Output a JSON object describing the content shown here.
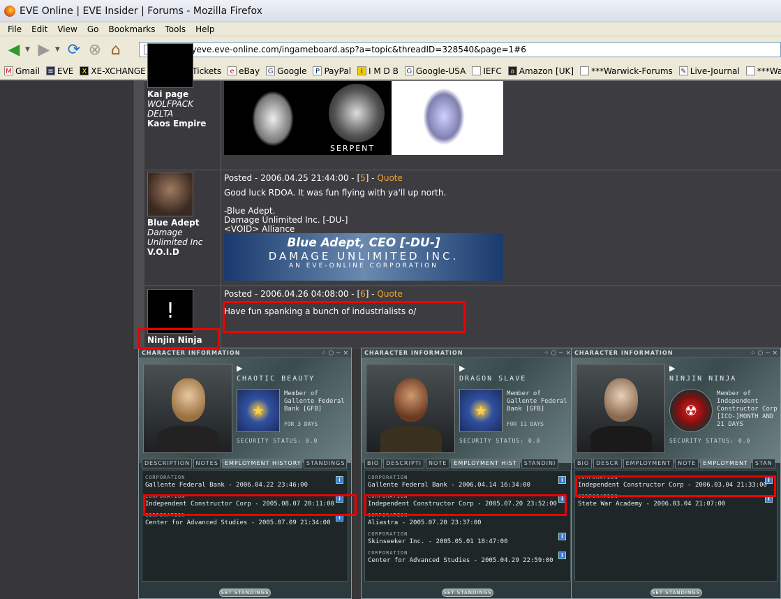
{
  "window": {
    "title": "EVE Online | EVE Insider | Forums - Mozilla Firefox"
  },
  "menu": [
    "File",
    "Edit",
    "View",
    "Go",
    "Bookmarks",
    "Tools",
    "Help"
  ],
  "nav": {
    "url": "http://myeve.eve-online.com/ingameboard.asp?a=topic&threadID=328540&page=1#6"
  },
  "bookmarks": [
    "Gmail",
    "EVE",
    "XE-XCHANGE",
    "Cheap-Tickets",
    "eBay",
    "Google",
    "PayPal",
    "I M D B",
    "Google-USA",
    "IEFC",
    "Amazon [UK]",
    "***Warwick-Forums",
    "Live-Journal",
    "***Warwick: Library"
  ],
  "posts": [
    {
      "user": "Kai page",
      "corp": "WOLFPACK DELTA",
      "alliance": "Kaos Empire",
      "banner_text": "SERPENT"
    },
    {
      "user": "Blue Adept",
      "corp": "Damage Unlimited Inc",
      "alliance": "V.O.I.D",
      "posted": "Posted - 2006.04.25 21:44:00 - [",
      "num": "5",
      "close": "] - ",
      "quote": "Quote",
      "lines": [
        "Good luck RDOA. It was fun flying with ya'll up north.",
        "",
        "-Blue Adept.",
        "Damage Unlimited Inc. [-DU-]",
        "<VOID> Alliance"
      ],
      "banner_title": "Blue Adept, CEO [-DU-]",
      "banner_sub": "DAMAGE UNLIMITED INC.",
      "banner_sub2": "AN EVE-ONLINE CORPORATION"
    },
    {
      "user": "Ninjin Ninja",
      "avatar_glyph": "!",
      "posted": "Posted - 2006.04.26 04:08:00 - [",
      "num": "6",
      "close": "] - ",
      "quote": "Quote",
      "lines": [
        "Have fun spanking a bunch of industrialists o/"
      ]
    }
  ],
  "char_windows": [
    {
      "header": "CHARACTER INFORMATION",
      "controls": "⁘ ○ − ×",
      "name": "CHAOTIC BEAUTY",
      "member": "Member of Gallente Federal Bank [GFB]",
      "days": "FOR 3 DAYS",
      "security": "SECURITY STATUS: 0.0",
      "tabs": [
        "DESCRIPTION",
        "NOTES",
        "EMPLOYMENT HISTORY",
        "STANDINGS"
      ],
      "active_tab": 2,
      "history": [
        {
          "label": "CORPORATION",
          "value": "Gallente Federal Bank - 2006.04.22 23:46:00"
        },
        {
          "label": "CORPORATION",
          "value": "Independent Constructor Corp - 2005.08.07 20:11:00"
        },
        {
          "label": "CORPORATION",
          "value": "Center for Advanced Studies - 2005.07.09 21:34:00"
        }
      ],
      "button": "SET STANDINGS"
    },
    {
      "header": "CHARACTER INFORMATION",
      "controls": "⁘ ○ − ×",
      "name": "DRAGON SLAVE",
      "member": "Member of Gallente Federal Bank [GFB]",
      "days": "FOR 11 DAYS",
      "security": "SECURITY STATUS: 0.0",
      "tabs": [
        "BIO",
        "DESCRIPTI",
        "NOTE",
        "EMPLOYMENT HIST",
        "STANDINI"
      ],
      "active_tab": 3,
      "history": [
        {
          "label": "CORPORATION",
          "value": "Gallente Federal Bank - 2006.04.14 16:34:00"
        },
        {
          "label": "CORPORATION",
          "value": "Independent Constructor Corp - 2005.07.20 23:52:00"
        },
        {
          "label": "CORPORATION",
          "value": "Aliastra - 2005.07.20 23:37:00"
        },
        {
          "label": "CORPORATION",
          "value": "Skinseeker Inc. - 2005.05.01 18:47:00"
        },
        {
          "label": "CORPORATION",
          "value": "Center for Advanced Studies - 2005.04.29 22:59:00"
        }
      ],
      "button": "SET STANDINGS"
    },
    {
      "header": "CHARACTER INFORMATION",
      "controls": "⁘ ○ − ×",
      "name": "NINJIN NINJA",
      "member": "Member of Independent Constructor Corp [ICO-]MONTH AND 21 DAYS",
      "days": "",
      "security": "SECURITY STATUS: 0.0",
      "tabs": [
        "BIO",
        "DESCR",
        "EMPLOYMENT",
        "NOTE",
        "EMPLOYMENT",
        "STAN"
      ],
      "active_tab": 4,
      "history": [
        {
          "label": "CORPORATION",
          "value": "Independent Constructor Corp - 2006.03.04 21:33:00"
        },
        {
          "label": "CORPORATION",
          "value": "State War Academy - 2006.03.04 21:07:00"
        }
      ],
      "button": "SET STANDINGS"
    }
  ]
}
